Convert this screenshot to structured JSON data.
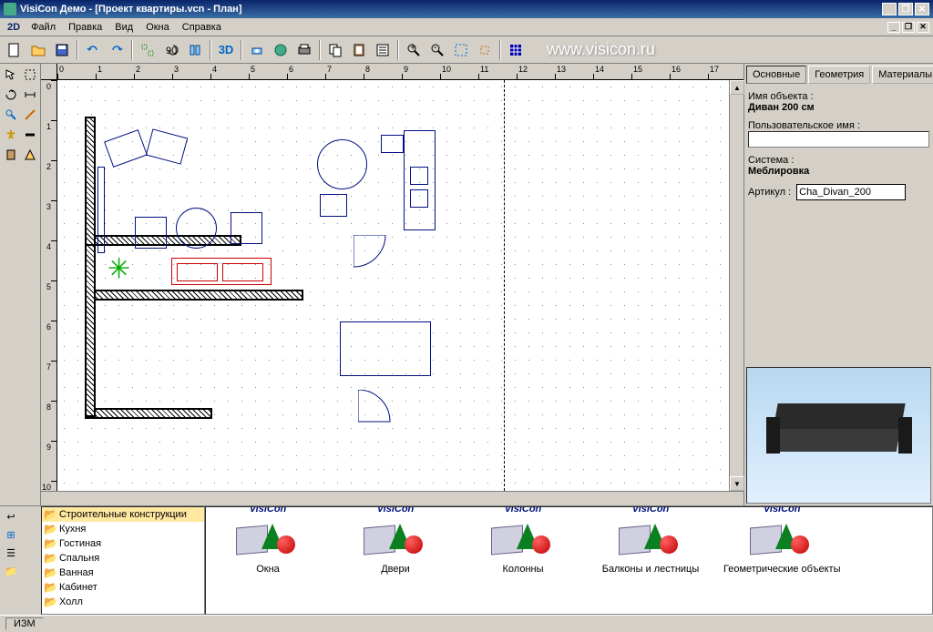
{
  "title": "VisiCon Демо - [Проект квартиры.vcn - План]",
  "mode_label": "2D",
  "menu": [
    "Файл",
    "Правка",
    "Вид",
    "Окна",
    "Справка"
  ],
  "btn3d": "3D",
  "url": "www.visicon.ru",
  "ruler_h": [
    "0",
    "1",
    "2",
    "3",
    "4",
    "5",
    "6",
    "7",
    "8",
    "9",
    "10",
    "11",
    "12",
    "13",
    "14",
    "15",
    "16",
    "17"
  ],
  "ruler_v": [
    "0",
    "1",
    "2",
    "3",
    "4",
    "5",
    "6",
    "7",
    "8",
    "9",
    "10"
  ],
  "tabs": {
    "main": "Основные",
    "geom": "Геометрия",
    "mat": "Материалы"
  },
  "props": {
    "name_label": "Имя объекта :",
    "name_value": "Диван 200 см",
    "user_label": "Пользовательское имя :",
    "user_value": "",
    "system_label": "Система :",
    "system_value": "Меблировка",
    "article_label": "Артикул :",
    "article_value": "Cha_Divan_200"
  },
  "tree": [
    {
      "label": "Строительные конструкции",
      "sel": true
    },
    {
      "label": "Кухня",
      "sel": false
    },
    {
      "label": "Гостиная",
      "sel": false
    },
    {
      "label": "Спальня",
      "sel": false
    },
    {
      "label": "Ванная",
      "sel": false
    },
    {
      "label": "Кабинет",
      "sel": false
    },
    {
      "label": "Холл",
      "sel": false
    }
  ],
  "catalog_brand": "VisiCon",
  "catalog": [
    "Окна",
    "Двери",
    "Колонны",
    "Балконы и лестницы",
    "Геометрические объекты"
  ],
  "status": "ИЗМ"
}
